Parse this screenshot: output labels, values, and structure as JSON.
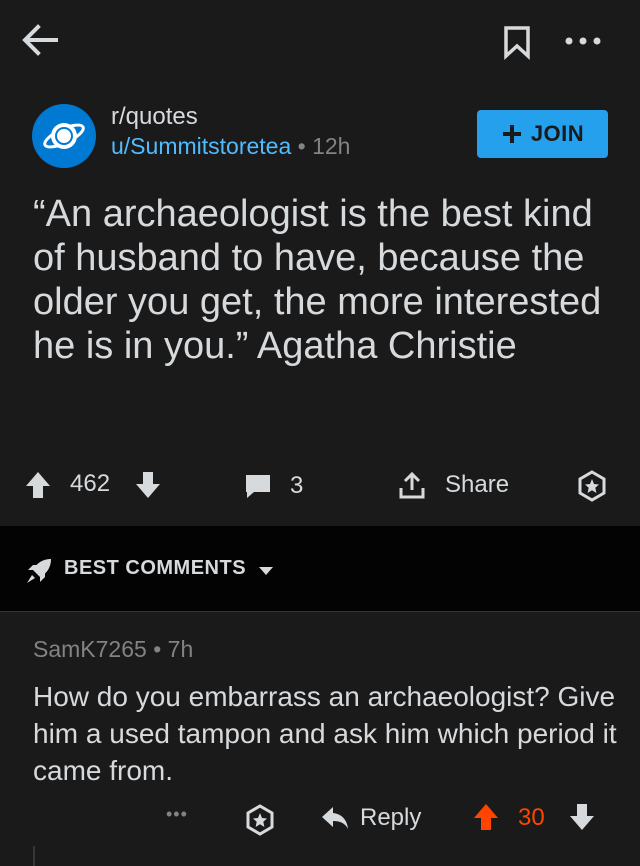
{
  "topbar": {
    "back_icon": "arrow-left-icon",
    "bookmark_icon": "bookmark-icon",
    "more_icon": "more-dots-icon"
  },
  "header": {
    "subreddit": "r/quotes",
    "user": "u/Summitstoretea",
    "separator": "•",
    "age": "12h",
    "join_label": "JOIN"
  },
  "post": {
    "title": "“An archaeologist is the best kind of husband to have, because the older you get, the more interested he is in you.” Agatha Christie",
    "votes": "462",
    "comments": "3",
    "share_label": "Share"
  },
  "sort": {
    "label": "BEST COMMENTS"
  },
  "comment": {
    "author": "SamK7265",
    "separator": "•",
    "age": "7h",
    "body": "How do you embarrass an archaeologist? Give him a used tampon and ask him which period it came from.",
    "more": "•••",
    "reply_label": "Reply",
    "votes": "30"
  },
  "colors": {
    "background": "#1a1a1b",
    "accent": "#24a0ed",
    "link": "#4fbcff",
    "upvoted": "#ff4500"
  }
}
